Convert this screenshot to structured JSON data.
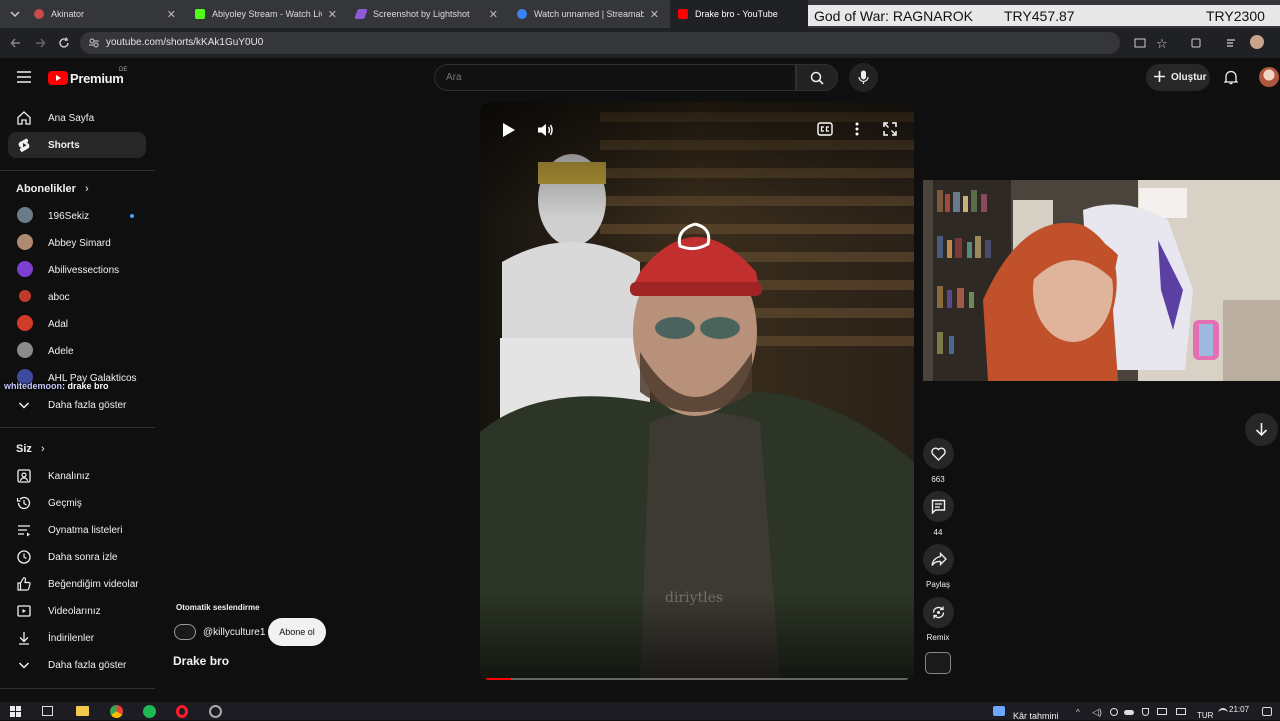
{
  "browser": {
    "tabs": [
      {
        "title": "Akinator",
        "color": "#c94a4a"
      },
      {
        "title": "Abiyoley Stream - Watch Live o",
        "color": "#53fc18"
      },
      {
        "title": "Screenshot by Lightshot",
        "color": "#8e5bd6"
      },
      {
        "title": "Watch unnamed | Streamable",
        "color": "#3b82f6"
      },
      {
        "title": "Drake bro - YouTube",
        "color": "#ff0000"
      }
    ],
    "url": "youtube.com/shorts/kKAk1GuY0U0",
    "overlay": {
      "game": "God of War: RAGNAROK",
      "price1": "TRY457.87",
      "price2": "TRY2300"
    }
  },
  "header": {
    "logo_text": "Premium",
    "region": "DE",
    "search_placeholder": "Ara",
    "create_label": "Oluştur"
  },
  "sidebar": {
    "main": [
      {
        "label": "Ana Sayfa",
        "icon": "home-icon"
      },
      {
        "label": "Shorts",
        "icon": "shorts-icon"
      }
    ],
    "subs_title": "Abonelikler",
    "subs": [
      {
        "label": "196Sekiz",
        "color": "#6b7b8c"
      },
      {
        "label": "Abbey Simard",
        "color": "#b08a70"
      },
      {
        "label": "Abilivessections",
        "color": "#7c3fd1"
      },
      {
        "label": "aboc",
        "color": "#c0392b"
      },
      {
        "label": "Adal",
        "color": "#d13b2a"
      },
      {
        "label": "Adele",
        "color": "#8b8b8b"
      },
      {
        "label": "AHL Pay Galakticos",
        "color": "#3d4b9e"
      }
    ],
    "chat_user": "whitedemoon",
    "chat_message": ": drake bro",
    "more_label": "Daha fazla göster",
    "you_title": "Siz",
    "you": [
      {
        "label": "Kanalınız",
        "icon": "channel-icon"
      },
      {
        "label": "Geçmiş",
        "icon": "history-icon"
      },
      {
        "label": "Oynatma listeleri",
        "icon": "playlist-icon"
      },
      {
        "label": "Daha sonra izle",
        "icon": "watch-later-icon"
      },
      {
        "label": "Beğendiğim videolar",
        "icon": "like-icon"
      },
      {
        "label": "Videolarınız",
        "icon": "your-videos-icon"
      },
      {
        "label": "İndirilenler",
        "icon": "download-icon"
      },
      {
        "label": "Daha fazla göster",
        "icon": "chevron-down-icon"
      }
    ]
  },
  "short": {
    "auto_dub": "Otomatik seslendirme",
    "channel": "@killyculture1",
    "subscribe_label": "Abone ol",
    "title": "Drake bro",
    "progress": 0.06,
    "video_watermark": "diriytles"
  },
  "actions": {
    "likes": "663",
    "comments": "44",
    "share": "Paylaş",
    "remix": "Remix"
  },
  "taskbar": {
    "weather": "Kâr tahmini",
    "lang": "TUR",
    "time": "21:07"
  }
}
